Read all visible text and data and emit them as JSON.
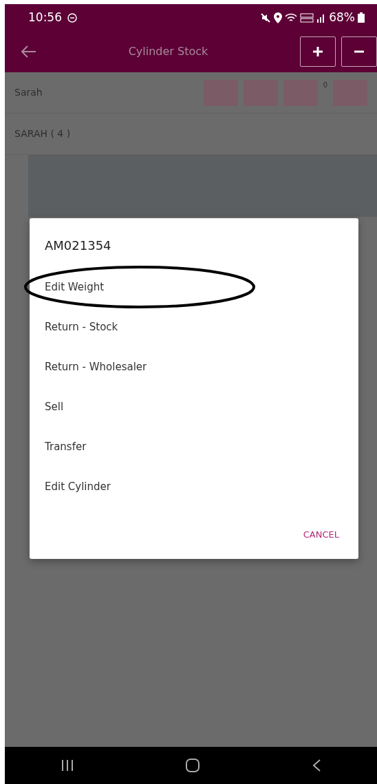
{
  "status_bar": {
    "time": "10:56",
    "battery": "68%"
  },
  "app_bar": {
    "title": "Cylinder Stock"
  },
  "background": {
    "user": "Sarah",
    "badge": "0",
    "group": "SARAH ( 4 )"
  },
  "dialog": {
    "title": "AM021354",
    "options": [
      {
        "label": "Edit Weight",
        "circled": true
      },
      {
        "label": "Return - Stock",
        "circled": false
      },
      {
        "label": "Return - Wholesaler",
        "circled": false
      },
      {
        "label": "Sell",
        "circled": false
      },
      {
        "label": "Transfer",
        "circled": false
      },
      {
        "label": "Edit Cylinder",
        "circled": false
      }
    ],
    "cancel": "CANCEL"
  }
}
